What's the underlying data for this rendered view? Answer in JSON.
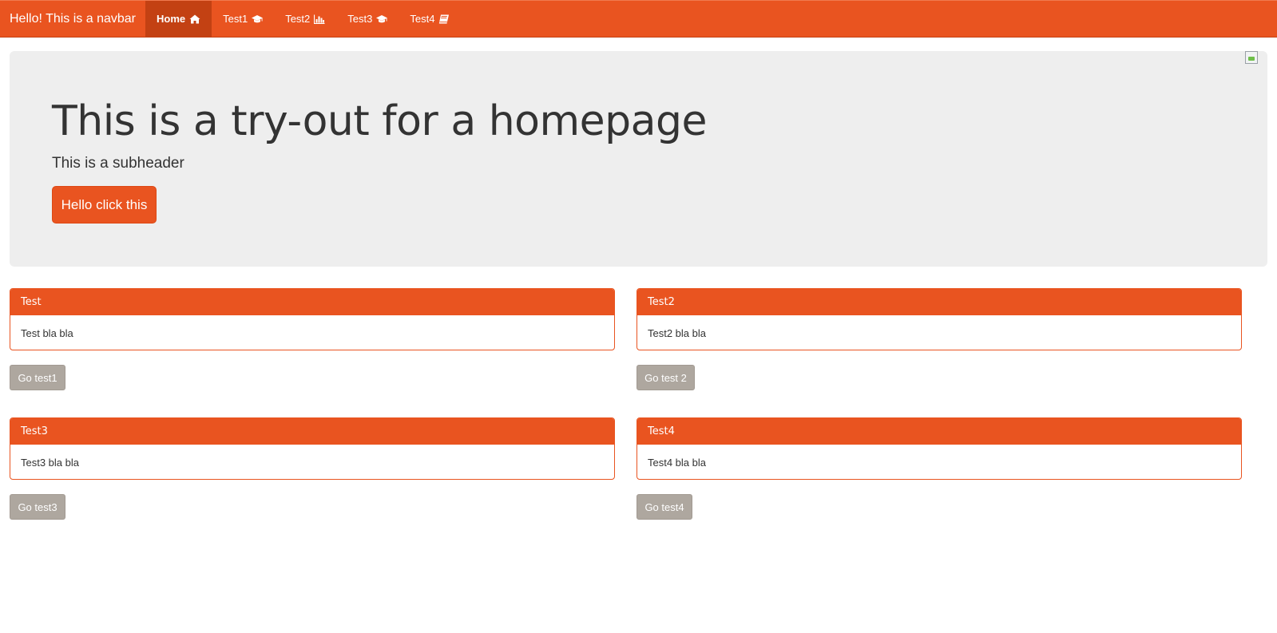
{
  "navbar": {
    "brand": "Hello! This is a navbar",
    "items": [
      {
        "label": "Home",
        "icon": "home-icon",
        "active": true
      },
      {
        "label": "Test1",
        "icon": "graduation-cap-icon"
      },
      {
        "label": "Test2",
        "icon": "bar-chart-icon"
      },
      {
        "label": "Test3",
        "icon": "graduation-cap-icon"
      },
      {
        "label": "Test4",
        "icon": "book-icon"
      }
    ],
    "color": "#e95420"
  },
  "jumbotron": {
    "title": "This is a try-out for a homepage",
    "subheader": "This is a subheader",
    "button_label": "Hello click this",
    "image": "broken-image-icon"
  },
  "panels": [
    {
      "heading": "Test",
      "body": "Test bla bla",
      "button_label": "Go test1"
    },
    {
      "heading": "Test2",
      "body": "Test2 bla bla",
      "button_label": "Go test 2"
    },
    {
      "heading": "Test3",
      "body": "Test3 bla bla",
      "button_label": "Go test3"
    },
    {
      "heading": "Test4",
      "body": "Test4 bla bla",
      "button_label": "Go test4"
    }
  ],
  "colors": {
    "accent": "#e95420",
    "accent_dark": "#c34113",
    "jumbotron_bg": "#eeeeee",
    "secondary_button": "#aea79f"
  }
}
